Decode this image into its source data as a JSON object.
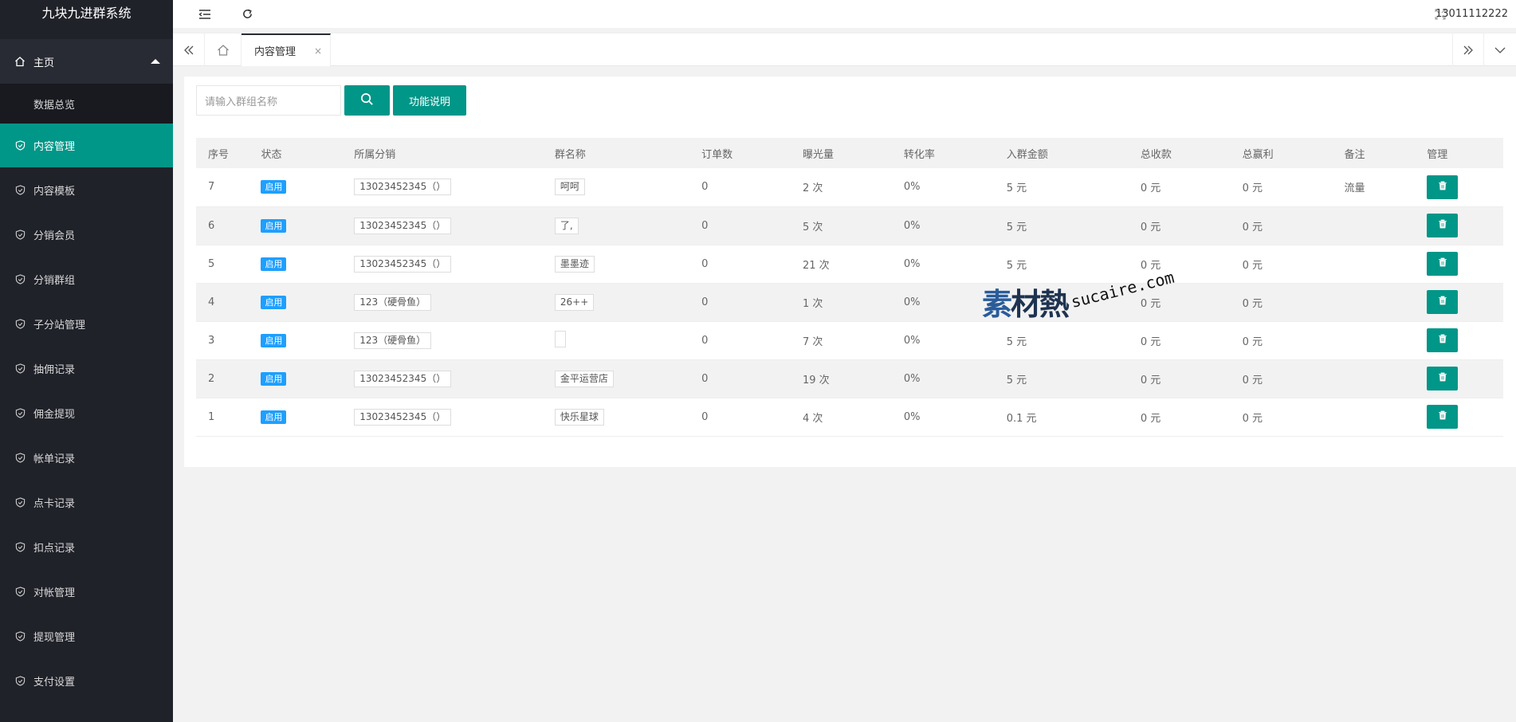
{
  "app": {
    "title": "九块九进群系统"
  },
  "sidebar": {
    "home": {
      "label": "主页"
    },
    "sub_items": [
      {
        "label": "数据总览"
      }
    ],
    "items": [
      {
        "label": "内容管理",
        "active": true
      },
      {
        "label": "内容模板"
      },
      {
        "label": "分销会员"
      },
      {
        "label": "分销群组"
      },
      {
        "label": "子分站管理"
      },
      {
        "label": "抽佣记录"
      },
      {
        "label": "佣金提现"
      },
      {
        "label": "帐单记录"
      },
      {
        "label": "点卡记录"
      },
      {
        "label": "扣点记录"
      },
      {
        "label": "对帐管理"
      },
      {
        "label": "提现管理"
      },
      {
        "label": "支付设置"
      }
    ]
  },
  "header": {
    "user": "13011112222"
  },
  "tabs": [
    {
      "label": "内容管理",
      "close": "×"
    }
  ],
  "search": {
    "placeholder": "请输入群组名称",
    "help_label": "功能说明"
  },
  "table": {
    "columns": [
      "序号",
      "状态",
      "所属分销",
      "群名称",
      "订单数",
      "曝光量",
      "转化率",
      "入群金额",
      "总收款",
      "总赢利",
      "备注",
      "管理"
    ],
    "rows": [
      {
        "id": "7",
        "status": "启用",
        "distributor": "13023452345（）",
        "group": "呵呵",
        "orders": "0",
        "views": "2 次",
        "rate": "0%",
        "fee": "5 元",
        "income": "0 元",
        "profit": "0 元",
        "note": "流量"
      },
      {
        "id": "6",
        "status": "启用",
        "distributor": "13023452345（）",
        "group": "了,",
        "orders": "0",
        "views": "5 次",
        "rate": "0%",
        "fee": "5 元",
        "income": "0 元",
        "profit": "0 元",
        "note": ""
      },
      {
        "id": "5",
        "status": "启用",
        "distributor": "13023452345（）",
        "group": "墨墨迹",
        "orders": "0",
        "views": "21 次",
        "rate": "0%",
        "fee": "5 元",
        "income": "0 元",
        "profit": "0 元",
        "note": ""
      },
      {
        "id": "4",
        "status": "启用",
        "distributor": "123（硬骨鱼）",
        "group": "26++",
        "orders": "0",
        "views": "1 次",
        "rate": "0%",
        "fee": "",
        "income": "0 元",
        "profit": "0 元",
        "note": ""
      },
      {
        "id": "3",
        "status": "启用",
        "distributor": "123（硬骨鱼）",
        "group": "",
        "orders": "0",
        "views": "7 次",
        "rate": "0%",
        "fee": "5 元",
        "income": "0 元",
        "profit": "0 元",
        "note": ""
      },
      {
        "id": "2",
        "status": "启用",
        "distributor": "13023452345（）",
        "group": "金平运营店",
        "orders": "0",
        "views": "19 次",
        "rate": "0%",
        "fee": "5 元",
        "income": "0 元",
        "profit": "0 元",
        "note": ""
      },
      {
        "id": "1",
        "status": "启用",
        "distributor": "13023452345（）",
        "group": "快乐星球",
        "orders": "0",
        "views": "4 次",
        "rate": "0%",
        "fee": "0.1 元",
        "income": "0 元",
        "profit": "0 元",
        "note": ""
      }
    ]
  },
  "watermark": {
    "cn_dark": "素",
    "cn_rest": "材熱",
    "en": "sucaire.com"
  },
  "colors": {
    "accent": "#009688",
    "sidebar_bg": "#20222a",
    "badge": "#1e9fff"
  }
}
